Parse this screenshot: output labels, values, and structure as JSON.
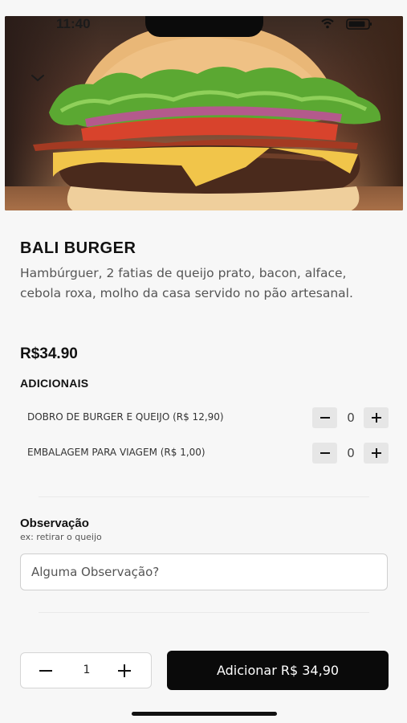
{
  "status_bar": {
    "time": "11:40"
  },
  "product": {
    "name": "BALI BURGER",
    "description": "Hambúrguer, 2 fatias de queijo prato, bacon, alface, cebola roxa, molho da casa servido no pão artesanal.",
    "price": "R$34.90"
  },
  "addons": {
    "title": "ADICIONAIS",
    "items": [
      {
        "label": "DOBRO DE BURGER E QUEIJO (R$ 12,90)",
        "count": "0"
      },
      {
        "label": "EMBALAGEM PARA VIAGEM (R$ 1,00)",
        "count": "0"
      }
    ]
  },
  "observation": {
    "title": "Observação",
    "hint": "ex: retirar o queijo",
    "placeholder": "Alguma Observação?"
  },
  "footer": {
    "quantity": "1",
    "add_label": "Adicionar R$ 34,90"
  },
  "icons": {
    "back": "chevron-down-icon",
    "minus": "minus-icon",
    "plus": "plus-icon",
    "wifi": "wifi-icon",
    "battery": "battery-icon"
  },
  "colors": {
    "primary_button": "#0a0a0a",
    "background": "#f7f7f7"
  }
}
